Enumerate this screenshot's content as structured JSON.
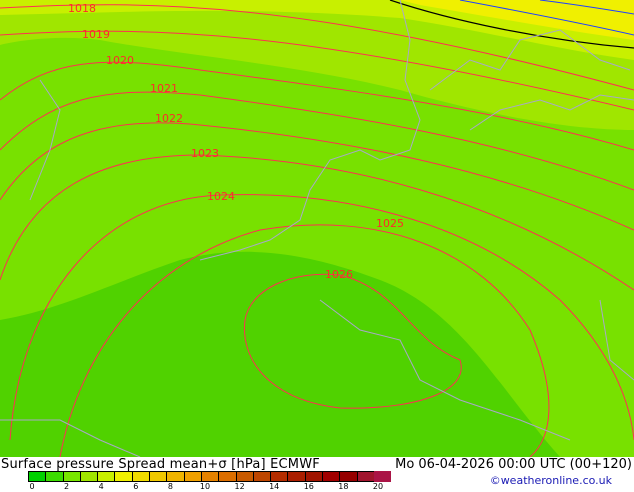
{
  "title": "Surface pressure Spread mean+σ [hPa] ECMWF",
  "datetime": "Mo 06-04-2026 00:00 UTC (00+120)",
  "credit": "©weatheronline.co.uk",
  "legend": {
    "colors": [
      "#00d200",
      "#3cdc00",
      "#78e600",
      "#a0e600",
      "#c8f000",
      "#f0f000",
      "#f0dc00",
      "#f0c800",
      "#f0b400",
      "#f0a000",
      "#e68200",
      "#dc6e00",
      "#c85a00",
      "#be4600",
      "#b42d00",
      "#aa1e00",
      "#a01400",
      "#a00000",
      "#960000",
      "#a0142d",
      "#aa1446"
    ],
    "ticks": [
      "0",
      "2",
      "4",
      "6",
      "8",
      "10",
      "12",
      "14",
      "16",
      "18",
      "20"
    ]
  },
  "isobar_labels": [
    "1018",
    "1019",
    "1020",
    "1021",
    "1022",
    "1023",
    "1024",
    "1025",
    "1026"
  ]
}
